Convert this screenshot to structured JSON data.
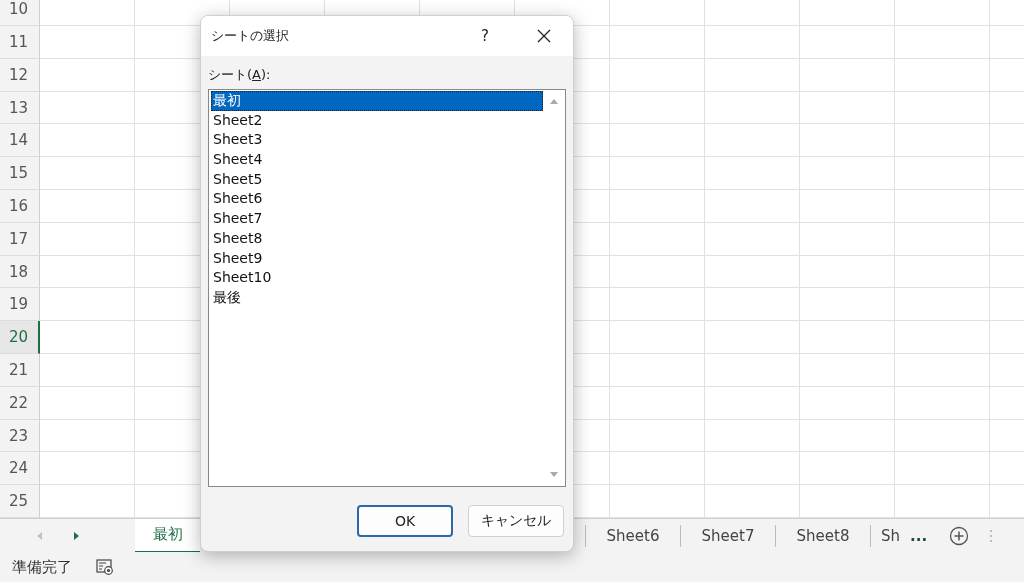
{
  "grid": {
    "rows": [
      {
        "number": "10",
        "selected": false
      },
      {
        "number": "11",
        "selected": false
      },
      {
        "number": "12",
        "selected": false
      },
      {
        "number": "13",
        "selected": false
      },
      {
        "number": "14",
        "selected": false
      },
      {
        "number": "15",
        "selected": false
      },
      {
        "number": "16",
        "selected": false
      },
      {
        "number": "17",
        "selected": false
      },
      {
        "number": "18",
        "selected": false
      },
      {
        "number": "19",
        "selected": false
      },
      {
        "number": "20",
        "selected": true
      },
      {
        "number": "21",
        "selected": false
      },
      {
        "number": "22",
        "selected": false
      },
      {
        "number": "23",
        "selected": false
      },
      {
        "number": "24",
        "selected": false
      },
      {
        "number": "25",
        "selected": false
      }
    ]
  },
  "sheet_tabs": {
    "tabs": [
      {
        "label": "最初",
        "selected": true
      },
      {
        "label": "Sheet6",
        "selected": false
      },
      {
        "label": "Sheet7",
        "selected": false
      },
      {
        "label": "Sheet8",
        "selected": false
      },
      {
        "label": "Sh",
        "selected": false
      }
    ],
    "overflow": "..."
  },
  "status_bar": {
    "text": "準備完了"
  },
  "dialog": {
    "title": "シートの選択",
    "help": "?",
    "list_label": [
      {
        "text": "シート(",
        "underlined": false
      },
      {
        "text": "A",
        "underlined": true
      },
      {
        "text": "):",
        "underlined": false
      }
    ],
    "items": [
      {
        "label": "最初",
        "selected": true
      },
      {
        "label": "Sheet2",
        "selected": false
      },
      {
        "label": "Sheet3",
        "selected": false
      },
      {
        "label": "Sheet4",
        "selected": false
      },
      {
        "label": "Sheet5",
        "selected": false
      },
      {
        "label": "Sheet6",
        "selected": false
      },
      {
        "label": "Sheet7",
        "selected": false
      },
      {
        "label": "Sheet8",
        "selected": false
      },
      {
        "label": "Sheet9",
        "selected": false
      },
      {
        "label": "Sheet10",
        "selected": false
      },
      {
        "label": "最後",
        "selected": false
      }
    ],
    "buttons": [
      {
        "label": "OK",
        "default": true
      },
      {
        "label": "キャンセル",
        "default": false
      }
    ]
  }
}
